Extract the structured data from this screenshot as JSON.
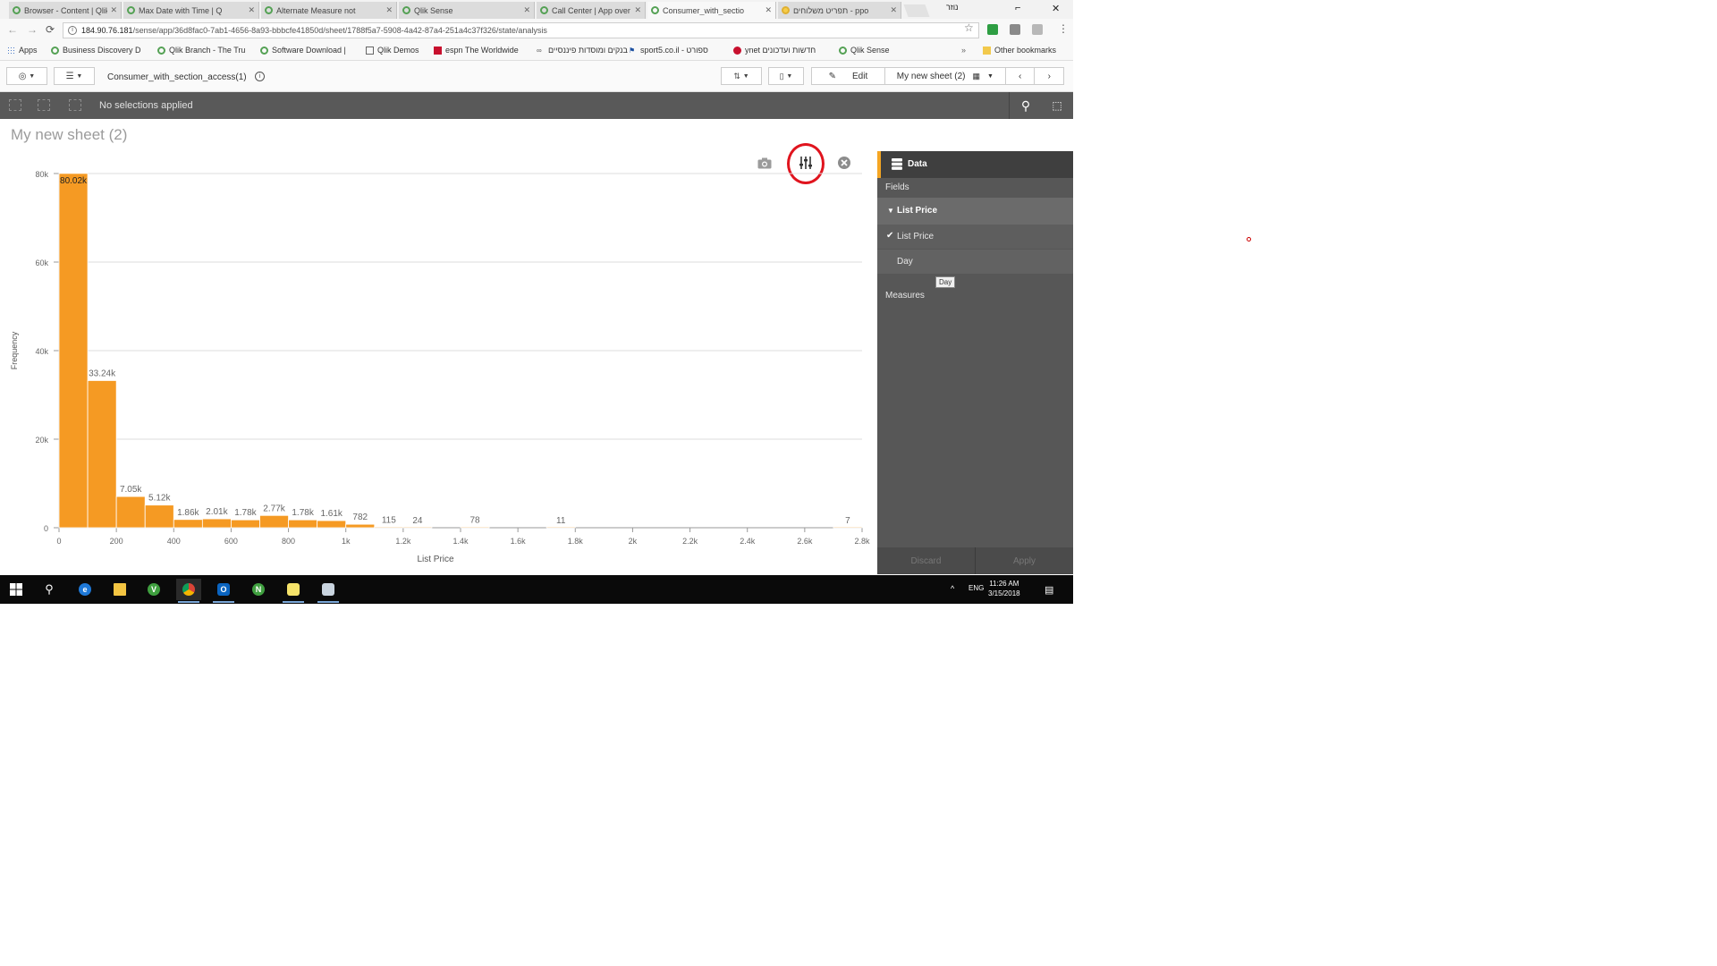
{
  "browser": {
    "tabs": [
      {
        "label": "Browser - Content | Qlik",
        "icon": "qlik-icon",
        "active": false
      },
      {
        "label": "Max Date with Time | Q",
        "icon": "qlik-icon",
        "active": false
      },
      {
        "label": "Alternate Measure not",
        "icon": "qlik-icon",
        "active": false
      },
      {
        "label": "Qlik Sense",
        "icon": "qlik-icon",
        "active": false
      },
      {
        "label": "Call Center | App over",
        "icon": "qlik-icon",
        "active": false
      },
      {
        "label": "Consumer_with_sectio",
        "icon": "qlik-icon",
        "active": true
      },
      {
        "label": "תפריט משלוחים - ppo",
        "icon": "lock-icon",
        "active": false
      }
    ],
    "window_label": "נוזר",
    "url_host": "184.90.76.181",
    "url_path": "/sense/app/36d8fac0-7ab1-4656-8a93-bbbcfe41850d/sheet/1788f5a7-5908-4a42-87a4-251a4c37f326/state/analysis",
    "bookmarks": [
      {
        "label": "Apps",
        "icon": "apps-grid-icon"
      },
      {
        "label": "Business Discovery D",
        "icon": "qlik-icon"
      },
      {
        "label": "Qlik Branch - The Tru",
        "icon": "qlik-icon"
      },
      {
        "label": "Software Download |",
        "icon": "qlik-icon"
      },
      {
        "label": "Qlik Demos",
        "icon": "page-icon"
      },
      {
        "label": "espn The Worldwide",
        "icon": "espn-icon"
      },
      {
        "label": "בנקים ומוסדות פיננסיים",
        "icon": "link-icon"
      },
      {
        "label": "sport5.co.il - ספורט",
        "icon": "sport-icon"
      },
      {
        "label": "ynet חדשות ועדכונים",
        "icon": "ynet-icon"
      },
      {
        "label": "Qlik Sense",
        "icon": "qlik-icon"
      },
      {
        "label": "Other bookmarks",
        "icon": "folder-icon"
      }
    ]
  },
  "toolbar": {
    "app_name": "Consumer_with_section_access(1)",
    "edit_label": "Edit",
    "sheet_selector": "My new sheet (2)"
  },
  "selections": {
    "text": "No selections applied"
  },
  "sheet": {
    "title": "My new sheet (2)"
  },
  "chart_data": {
    "type": "bar",
    "title": "",
    "xlabel": "List Price",
    "ylabel": "Frequency",
    "x_ticks": [
      "0",
      "200",
      "400",
      "600",
      "800",
      "1k",
      "1.2k",
      "1.4k",
      "1.6k",
      "1.8k",
      "2k",
      "2.2k",
      "2.4k",
      "2.6k",
      "2.8k"
    ],
    "y_ticks": [
      "0",
      "20k",
      "40k",
      "60k",
      "80k"
    ],
    "ylim": [
      0,
      80000
    ],
    "xlim": [
      0,
      2800
    ],
    "bin_width": 100,
    "bins": [
      {
        "x0": 0,
        "value": 80020,
        "label": "80.02k"
      },
      {
        "x0": 100,
        "value": 33240,
        "label": "33.24k"
      },
      {
        "x0": 200,
        "value": 7050,
        "label": "7.05k"
      },
      {
        "x0": 300,
        "value": 5120,
        "label": "5.12k"
      },
      {
        "x0": 400,
        "value": 1860,
        "label": "1.86k"
      },
      {
        "x0": 500,
        "value": 2010,
        "label": "2.01k"
      },
      {
        "x0": 600,
        "value": 1780,
        "label": "1.78k"
      },
      {
        "x0": 700,
        "value": 2770,
        "label": "2.77k"
      },
      {
        "x0": 800,
        "value": 1780,
        "label": "1.78k"
      },
      {
        "x0": 900,
        "value": 1610,
        "label": "1.61k"
      },
      {
        "x0": 1000,
        "value": 782,
        "label": "782"
      },
      {
        "x0": 1100,
        "value": 115,
        "label": "115"
      },
      {
        "x0": 1200,
        "value": 24,
        "label": "24"
      },
      {
        "x0": 1400,
        "value": 78,
        "label": "78"
      },
      {
        "x0": 1500,
        "value": 0,
        "label": ""
      },
      {
        "x0": 1600,
        "value": 0,
        "label": ""
      },
      {
        "x0": 1700,
        "value": 11,
        "label": "11"
      },
      {
        "x0": 2700,
        "value": 7,
        "label": "7"
      }
    ],
    "bar_color": "#f59a23",
    "grid": true
  },
  "panel": {
    "title": "Data",
    "fields_label": "Fields",
    "field_group": "List Price",
    "fields": [
      {
        "label": "List Price",
        "checked": true
      },
      {
        "label": "Day",
        "checked": false
      }
    ],
    "tooltip": "Day",
    "measures_label": "Measures",
    "discard_label": "Discard",
    "apply_label": "Apply"
  },
  "taskbar": {
    "apps": [
      "windows-start-icon",
      "search-icon",
      "edge-icon",
      "file-explorer-icon",
      "qlikview-icon",
      "chrome-icon",
      "outlook-icon",
      "qlik-nprinting-icon",
      "sticky-notes-icon",
      "app-icon"
    ],
    "lang": "ENG",
    "time": "11:26 AM",
    "date": "3/15/2018"
  },
  "colors": {
    "accent": "#f5a623",
    "bar": "#f59a23",
    "highlight": "#e0141e",
    "selection_bar": "#595959",
    "panel": "#575757"
  }
}
